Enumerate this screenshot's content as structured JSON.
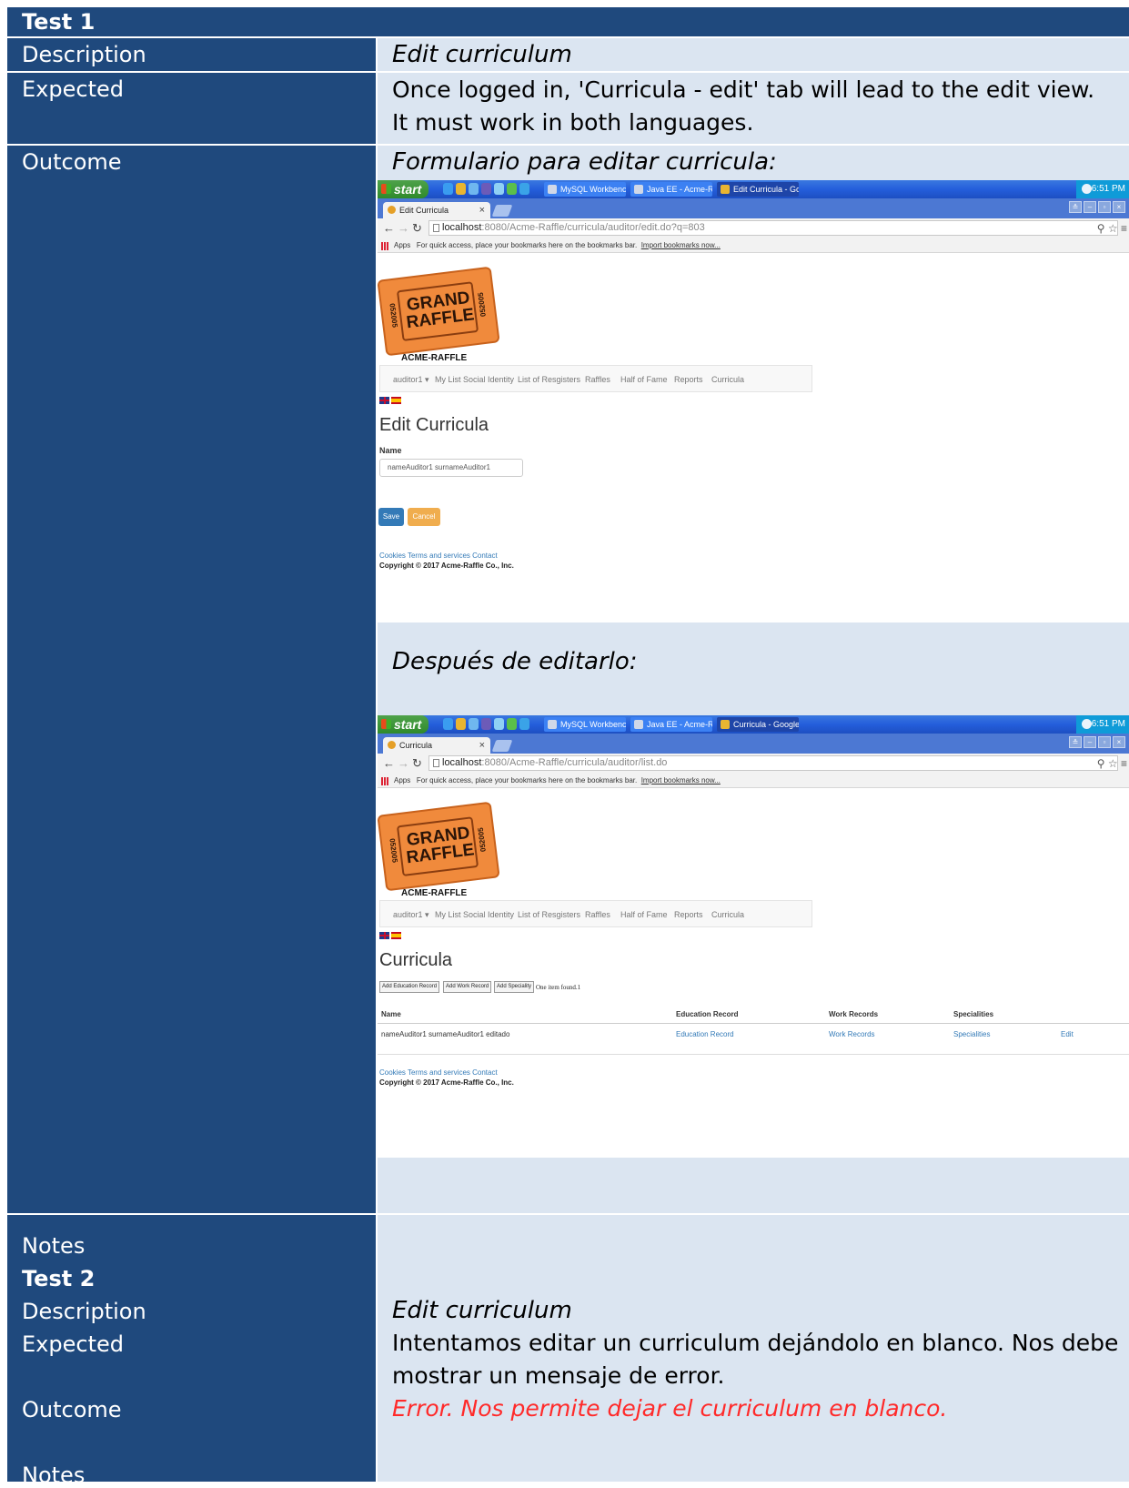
{
  "test1": {
    "title": "Test 1",
    "rows": {
      "description_label": "Description",
      "description_value": "Edit curriculum",
      "expected_label": "Expected",
      "expected_line1": "Once logged in, 'Curricula - edit' tab will lead to the edit view.",
      "expected_line2": "It must work in both languages.",
      "outcome_label": "Outcome",
      "outcome_caption1": "Formulario para editar curricula:",
      "outcome_caption2": "Después de editarlo:",
      "notes_label": "Notes"
    }
  },
  "test2": {
    "title": "Test 2",
    "description_label": "Description",
    "description_value": "Edit curriculum",
    "expected_label": "Expected",
    "expected_line1": "Intentamos editar un curriculum dejándolo en blanco. Nos debe",
    "expected_line2": "mostrar un mensaje de error.",
    "outcome_label": "Outcome",
    "outcome_value": "Error. Nos permite dejar el curriculum en blanco.",
    "notes_label": "Notes"
  },
  "screenshot1": {
    "taskbar": {
      "start": "start",
      "tasks": [
        "MySQL Workbench",
        "Java EE - Acme-Raffl...",
        "Edit Curricula - Googl..."
      ],
      "time": "6:51 PM"
    },
    "tab_title": "Edit Curricula",
    "url_host": "localhost",
    "url_path": ":8080/Acme-Raffle/curricula/auditor/edit.do?q=803",
    "bookmarks_apps": "Apps",
    "bookmarks_text": "For quick access, place your bookmarks here on the bookmarks bar.",
    "bookmarks_link": "Import bookmarks now...",
    "logo_line1": "GRAND",
    "logo_line2": "RAFFLE",
    "logo_number": "052005",
    "site_name": "ACME-RAFFLE",
    "nav": [
      "auditor1 ▾",
      "My List Social Identity",
      "List of Resgisters",
      "Raffles",
      "Half of Fame",
      "Reports",
      "Curricula"
    ],
    "page_title": "Edit Curricula",
    "field_label": "Name",
    "field_value": "nameAuditor1 surnameAuditor1",
    "save": "Save",
    "cancel": "Cancel",
    "footer_links": "Cookies Terms and services Contact",
    "copyright": "Copyright © 2017 Acme-Raffle Co., Inc."
  },
  "screenshot2": {
    "taskbar": {
      "start": "start",
      "tasks": [
        "MySQL Workbench",
        "Java EE - Acme-Raffl...",
        "Curricula - Google Ch..."
      ],
      "time": "6:51 PM"
    },
    "tab_title": "Curricula",
    "url_host": "localhost",
    "url_path": ":8080/Acme-Raffle/curricula/auditor/list.do",
    "bookmarks_apps": "Apps",
    "bookmarks_text": "For quick access, place your bookmarks here on the bookmarks bar.",
    "bookmarks_link": "Import bookmarks now...",
    "logo_line1": "GRAND",
    "logo_line2": "RAFFLE",
    "logo_number": "052005",
    "site_name": "ACME-RAFFLE",
    "nav": [
      "auditor1 ▾",
      "My List Social Identity",
      "List of Resgisters",
      "Raffles",
      "Half of Fame",
      "Reports",
      "Curricula"
    ],
    "page_title": "Curricula",
    "actions": [
      "Add Education Record",
      "Add Work Record",
      "Add Speciality"
    ],
    "found": "One item found.1",
    "table": {
      "headers": [
        "Name",
        "Education Record",
        "Work Records",
        "Specialities"
      ],
      "row": [
        "nameAuditor1 surnameAuditor1 editado",
        "Education Record",
        "Work Records",
        "Specialities",
        "Edit"
      ]
    },
    "footer_links": "Cookies Terms and services Contact",
    "copyright": "Copyright © 2017 Acme-Raffle Co., Inc."
  },
  "colors": {
    "navy": "#1f497d",
    "light_blue": "#dbe5f1",
    "error_red": "#ff2a2a",
    "primary": "#337ab7",
    "warning": "#f0ad4e"
  }
}
